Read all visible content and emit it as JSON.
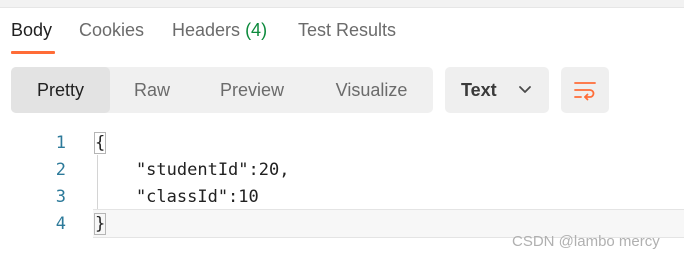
{
  "tabs": [
    {
      "label": "Body"
    },
    {
      "label": "Cookies"
    },
    {
      "label": "Headers",
      "count": "(4)"
    },
    {
      "label": "Test Results"
    }
  ],
  "view_modes": [
    "Pretty",
    "Raw",
    "Preview",
    "Visualize"
  ],
  "active_view_mode": "Pretty",
  "format_select": {
    "value": "Text"
  },
  "editor": {
    "line_numbers": [
      "1",
      "2",
      "3",
      "4"
    ],
    "lines": [
      "{",
      "    \"studentId\":20,",
      "    \"classId\":10",
      "}"
    ]
  },
  "watermark": "CSDN @lambo mercy",
  "colors": {
    "accent": "#ff6c37",
    "count": "#0c8a3c",
    "line_number": "#2d7a9a"
  }
}
